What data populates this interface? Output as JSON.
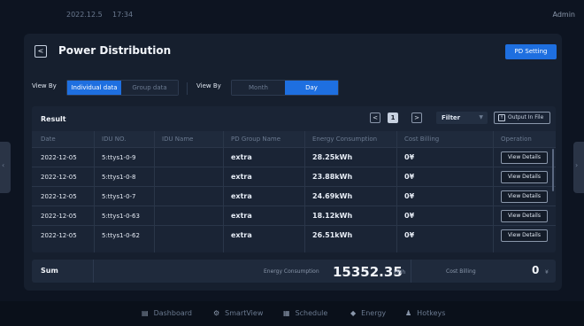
{
  "topbar": {
    "date": "2022.12.5",
    "time": "17:34",
    "user": "Admin"
  },
  "page": {
    "title": "Power Distribution",
    "back": "<",
    "pd_setting": "PD Setting"
  },
  "filters": {
    "view_by_label_1": "View By",
    "data_options": [
      "Individual data",
      "Group data"
    ],
    "data_selected": "Individual data",
    "view_by_label_2": "View By",
    "period_options": [
      "Month",
      "Day"
    ],
    "period_selected": "Day"
  },
  "result": {
    "label": "Result",
    "pager": {
      "prev": "<",
      "page": "1",
      "next": ">"
    },
    "filter_label": "Filter",
    "output_label": "Output In File",
    "columns": [
      "Date",
      "IDU NO.",
      "IDU Name",
      "PD Group Name",
      "Energy Consumption",
      "Cost Billing",
      "Operation"
    ],
    "rows": [
      {
        "date": "2022-12-05",
        "idu_no": "5:ttys1-0-9",
        "idu_name": "",
        "group": "extra",
        "energy": "28.25kWh",
        "cost": "0¥",
        "action": "View Details"
      },
      {
        "date": "2022-12-05",
        "idu_no": "5:ttys1-0-8",
        "idu_name": "",
        "group": "extra",
        "energy": "23.88kWh",
        "cost": "0¥",
        "action": "View Details"
      },
      {
        "date": "2022-12-05",
        "idu_no": "5:ttys1-0-7",
        "idu_name": "",
        "group": "extra",
        "energy": "24.69kWh",
        "cost": "0¥",
        "action": "View Details"
      },
      {
        "date": "2022-12-05",
        "idu_no": "5:ttys1-0-63",
        "idu_name": "",
        "group": "extra",
        "energy": "18.12kWh",
        "cost": "0¥",
        "action": "View Details"
      },
      {
        "date": "2022-12-05",
        "idu_no": "5:ttys1-0-62",
        "idu_name": "",
        "group": "extra",
        "energy": "26.51kWh",
        "cost": "0¥",
        "action": "View Details"
      }
    ]
  },
  "sum": {
    "label": "Sum",
    "energy_label": "Energy Consumption",
    "energy_value": "15352.35",
    "energy_unit": "kWh",
    "cost_label": "Cost Billing",
    "cost_value": "0",
    "cost_unit": "¥"
  },
  "nav": {
    "items": [
      {
        "label": "Dashboard",
        "icon": "dashboard-icon"
      },
      {
        "label": "SmartView",
        "icon": "gear-icon"
      },
      {
        "label": "Schedule",
        "icon": "calendar-icon"
      },
      {
        "label": "Energy",
        "icon": "diamond-icon"
      },
      {
        "label": "Hotkeys",
        "icon": "person-icon"
      }
    ]
  },
  "colors": {
    "accent": "#1e6fe0",
    "background": "#0d1421",
    "panel": "#161f2e"
  }
}
